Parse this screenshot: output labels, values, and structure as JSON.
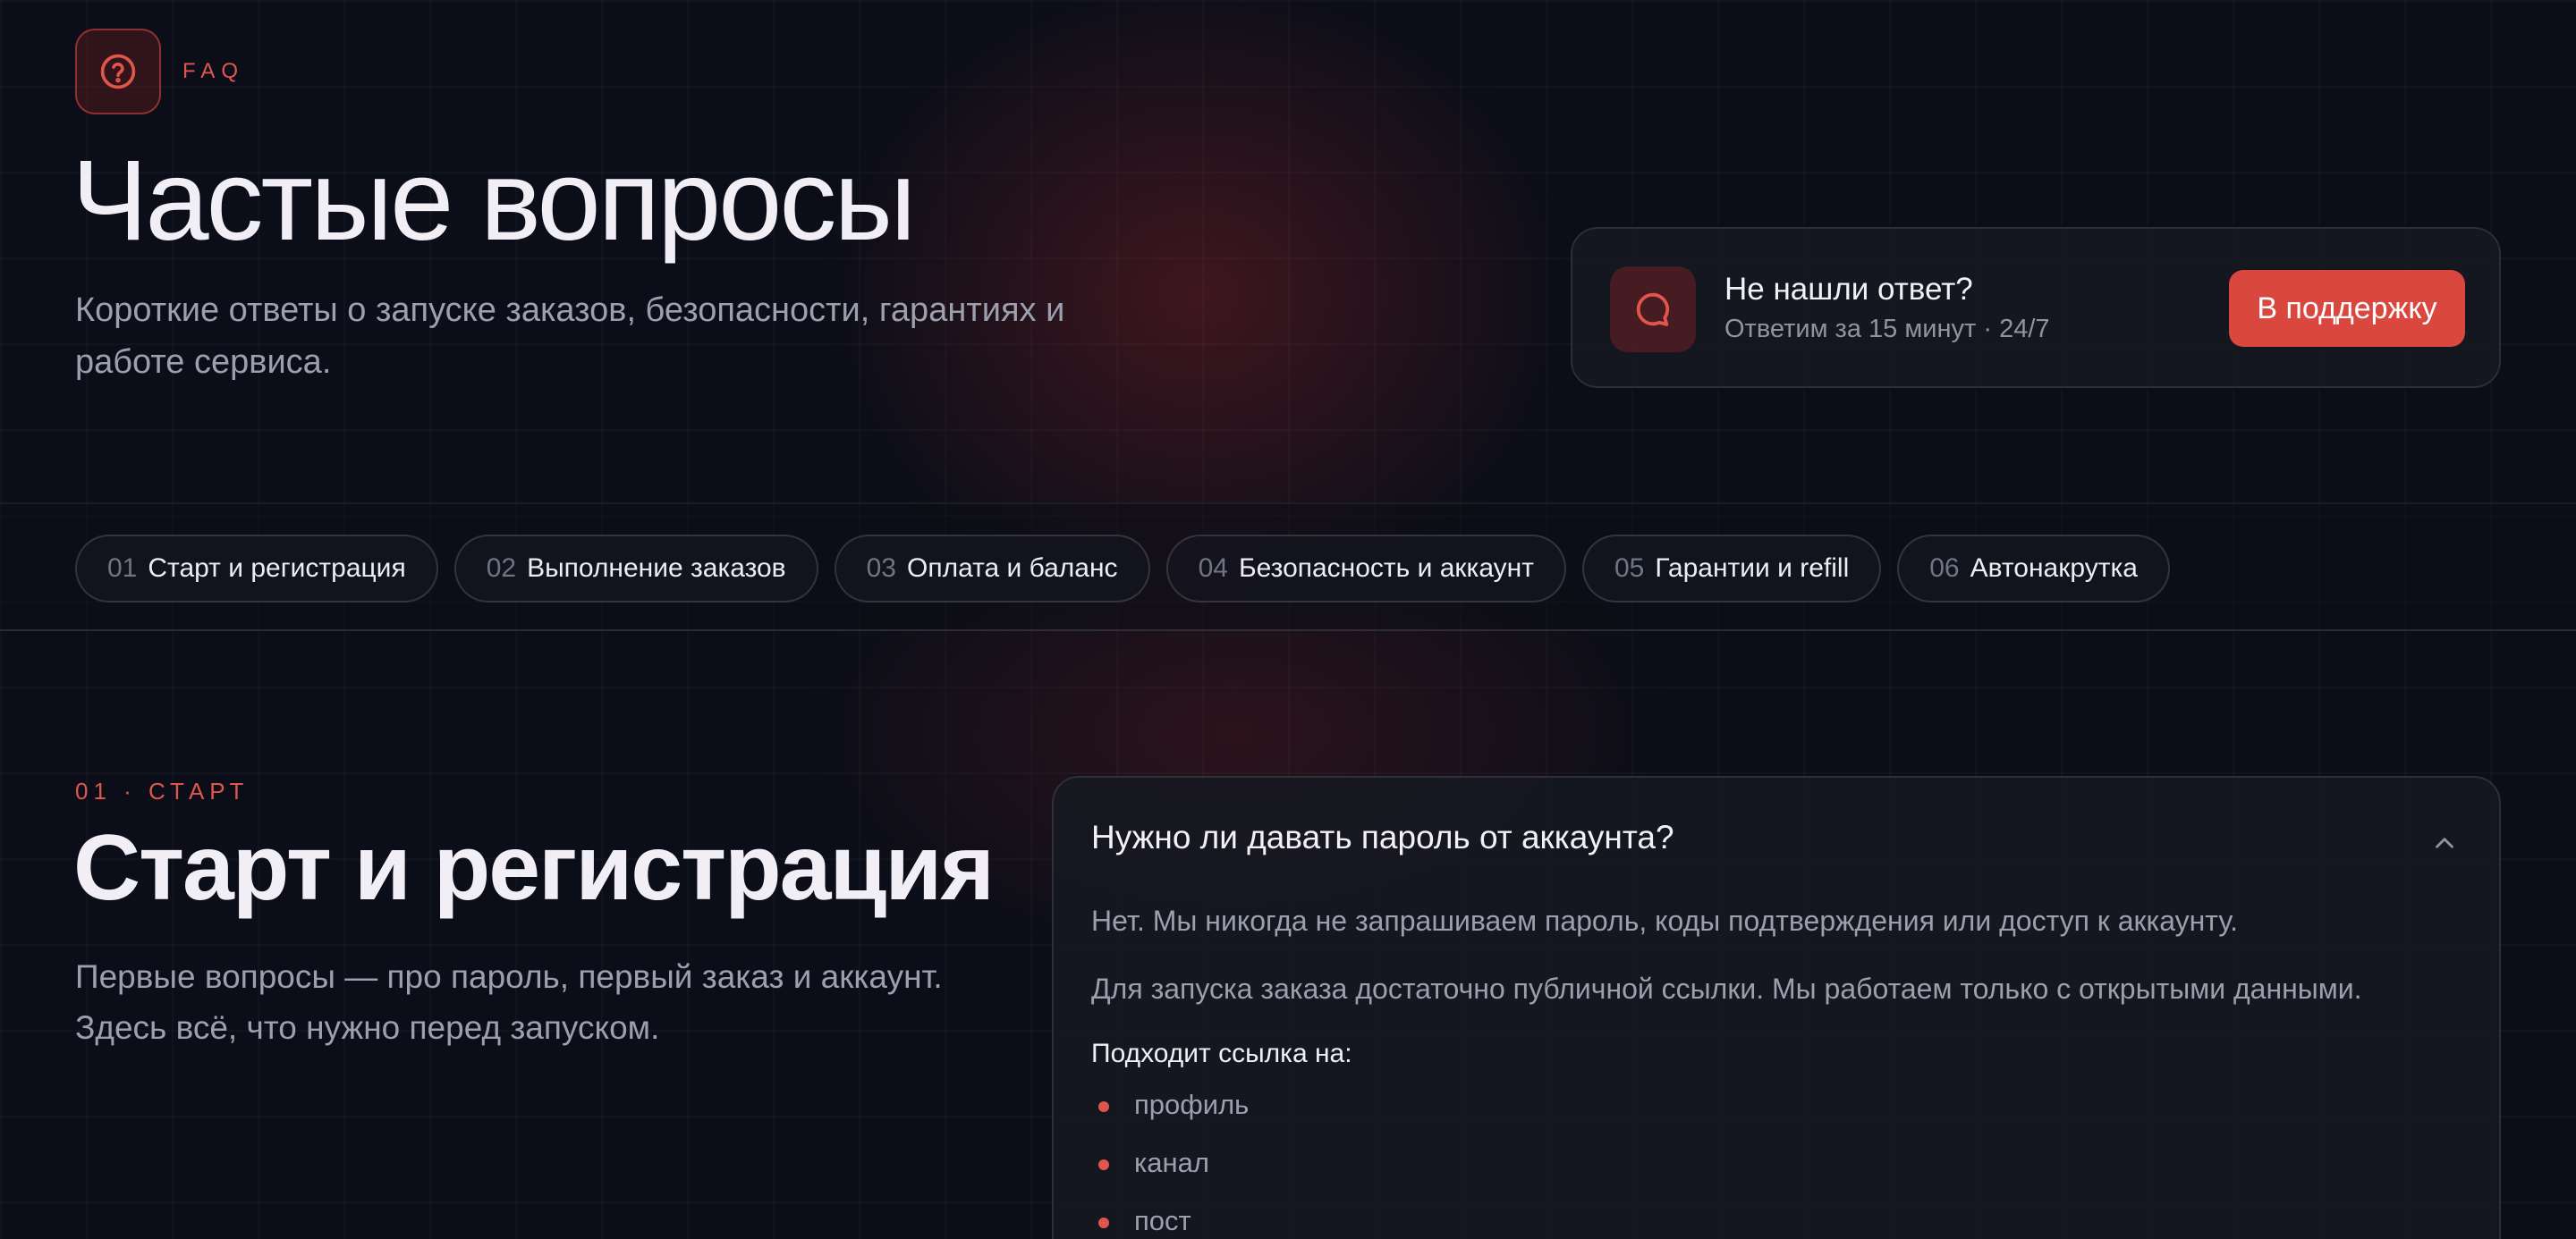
{
  "header": {
    "eyebrow": "FAQ",
    "title": "Частые вопросы",
    "subtitle": "Короткие ответы о запуске заказов, безопасности, гарантиях и работе сервиса.",
    "badge_icon": "question-circle-icon"
  },
  "support": {
    "icon": "chat-bubble-icon",
    "title": "Не нашли ответ?",
    "subtitle": "Ответим за 15 минут · 24/7",
    "button_label": "В поддержку"
  },
  "tabs": [
    {
      "num": "01",
      "label": "Старт и регистрация"
    },
    {
      "num": "02",
      "label": "Выполнение заказов"
    },
    {
      "num": "03",
      "label": "Оплата и баланс"
    },
    {
      "num": "04",
      "label": "Безопасность и аккаунт"
    },
    {
      "num": "05",
      "label": "Гарантии и refill"
    },
    {
      "num": "06",
      "label": "Автонакрутка"
    }
  ],
  "section": {
    "eyebrow": "01 · СТАРТ",
    "title": "Старт и регистрация",
    "subtitle": "Первые вопросы — про пароль, первый заказ и аккаунт. Здесь всё, что нужно перед запуском."
  },
  "faq": {
    "question": "Нужно ли давать пароль от аккаунта?",
    "answer_1": "Нет. Мы никогда не запрашиваем пароль, коды подтверждения или доступ к аккаунту.",
    "answer_2": "Для запуска заказа достаточно публичной ссылки. Мы работаем только с открытыми данными.",
    "list_title": "Подходит ссылка на:",
    "list": [
      "профиль",
      "канал",
      "пост"
    ],
    "expanded_icon": "chevron-up-icon"
  },
  "colors": {
    "accent": "#d9473f",
    "background": "#0b0e18",
    "card": "#161822",
    "muted_text": "#9b9fae"
  }
}
